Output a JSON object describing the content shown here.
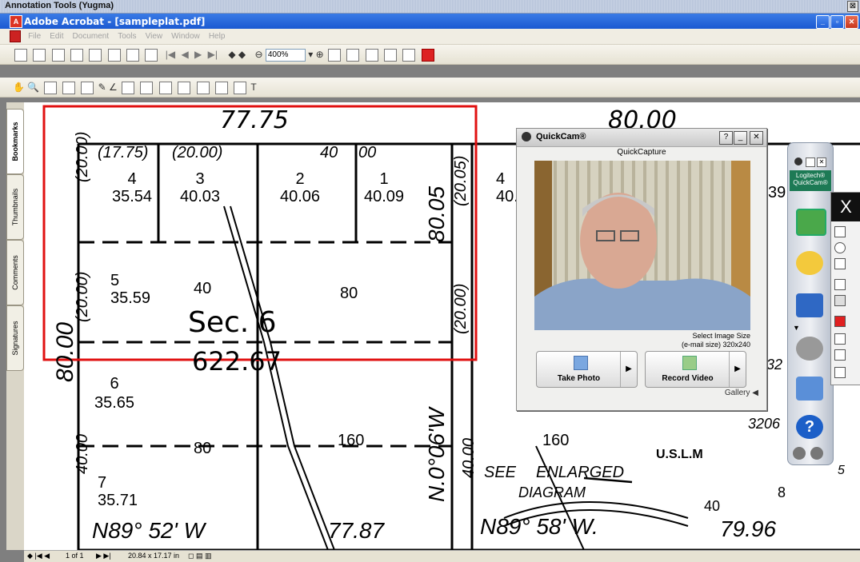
{
  "annotation_bar": {
    "title": "Annotation Tools (Yugma)",
    "close": "⊠"
  },
  "window": {
    "title": "Adobe Acrobat - [sampleplat.pdf]",
    "min": "_",
    "max": "▫",
    "close": "✕"
  },
  "menu": {
    "items": [
      "File",
      "Edit",
      "Document",
      "Tools",
      "View",
      "Window",
      "Help"
    ]
  },
  "toolbar1": {
    "zoom": "400%",
    "adobe_label": "Adobe"
  },
  "sidebar": {
    "tabs": [
      "Bookmarks",
      "Thumbnails",
      "Comments",
      "Signatures"
    ]
  },
  "plat": {
    "top_left": "77.75",
    "top_right": "80.00",
    "lot_hdr": [
      "(17.75)",
      "(20.00)",
      "40",
      "00"
    ],
    "lots_row1": [
      {
        "num": "4",
        "area": "35.54"
      },
      {
        "num": "3",
        "area": "40.03"
      },
      {
        "num": "2",
        "area": "40.06"
      },
      {
        "num": "1",
        "area": "40.09"
      }
    ],
    "left_v1": "(20.00)",
    "left_v2": "(20.00)",
    "right_v1": "(20.05)",
    "right_v2": "(20.00)",
    "right_val1": "80.05",
    "lot5": {
      "num": "5",
      "area": "35.59"
    },
    "forty": "40",
    "eighty": "80",
    "sec": "Sec. 6",
    "mid_line": "622.67",
    "left_dist": "80.00",
    "lot6": {
      "num": "6",
      "area": "35.65"
    },
    "lot7": {
      "num": "7",
      "area": "35.71"
    },
    "left_40": "40.00",
    "eighty_b": "80",
    "one60": "160",
    "one60b": "160",
    "north_bearing": "N.0°06'W",
    "right_40": "40.00",
    "bottom_left": "N89° 52' W",
    "bottom_mid": "77.87",
    "bottom_right": "N89° 58' W.",
    "bottom_right_dist": "79.96",
    "see": "SEE",
    "enlarged": "ENLARGED",
    "diagram": "DIAGRAM",
    "uslm": "U.S.L.M",
    "forty_b": "40",
    "eight": "8",
    "lot4r": "4",
    "lot4r_area": "40.0",
    "num39": "39",
    "num32": "32",
    "num3206": "3206",
    "num5": "5"
  },
  "status": {
    "page": "1 of 1",
    "size": "20.84 x 17.17 in"
  },
  "quickcam": {
    "title": "QuickCam®",
    "subtitle": "QuickCapture",
    "help": "?",
    "info_line1": "Select Image Size",
    "info_line2": "(e-mail size) 320x240",
    "take_photo": "Take Photo",
    "record_video": "Record Video",
    "gallery": "Gallery"
  },
  "dock": {
    "brand": "Logitech® QuickCam®",
    "help": "?"
  },
  "colors": {
    "title_blue": "#1b59d1",
    "highlight_red": "#e01010"
  }
}
